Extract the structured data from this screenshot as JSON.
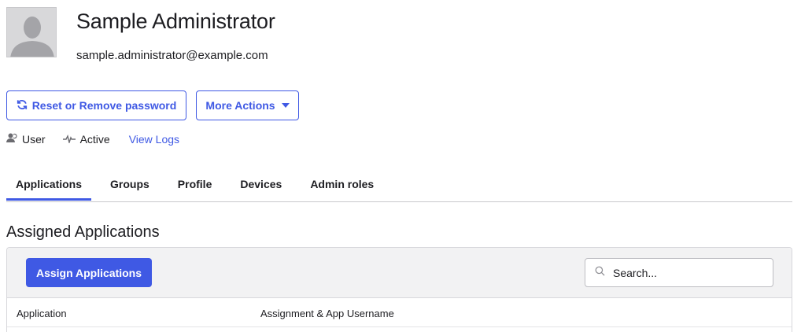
{
  "user": {
    "name": "Sample Administrator",
    "email": "sample.administrator@example.com"
  },
  "actions": {
    "reset_label": "Reset or Remove password",
    "more_label": "More Actions"
  },
  "meta": {
    "role": "User",
    "status": "Active",
    "logs_link": "View Logs"
  },
  "tabs": [
    {
      "label": "Applications",
      "active": true
    },
    {
      "label": "Groups",
      "active": false
    },
    {
      "label": "Profile",
      "active": false
    },
    {
      "label": "Devices",
      "active": false
    },
    {
      "label": "Admin roles",
      "active": false
    }
  ],
  "section": {
    "title": "Assigned Applications",
    "assign_button": "Assign Applications",
    "search_placeholder": "Search...",
    "columns": [
      "Application",
      "Assignment & App Username"
    ]
  },
  "colors": {
    "accent": "#3f59e4",
    "tab_underline": "#3f59e4"
  },
  "icons": {
    "avatar": "person-silhouette-icon",
    "reset": "refresh-icon",
    "more": "caret-down-icon",
    "user": "user-icon",
    "status": "activity-icon",
    "search": "search-icon"
  }
}
